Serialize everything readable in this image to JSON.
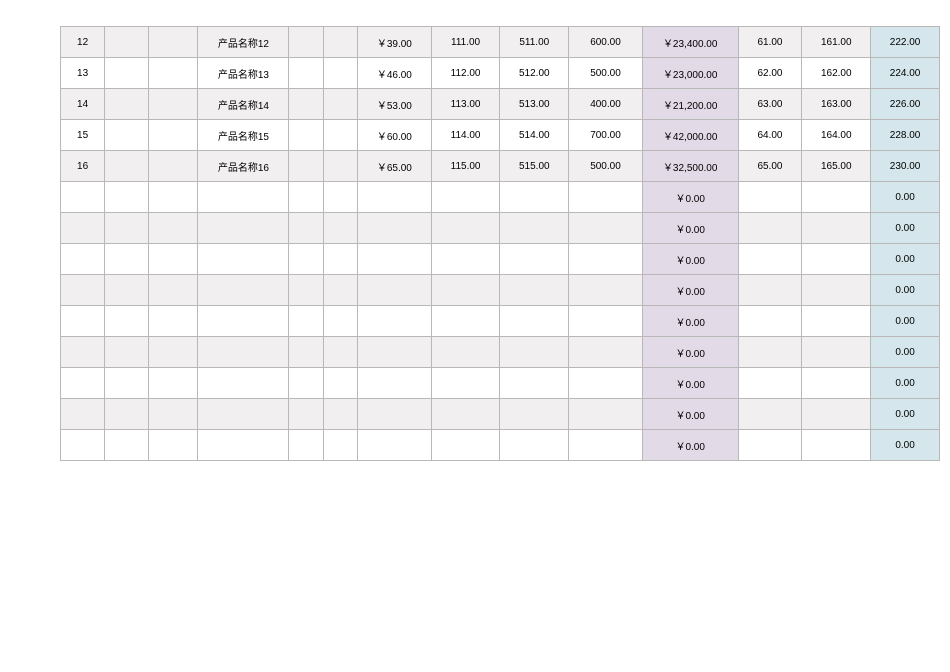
{
  "rows": [
    {
      "id": "12",
      "name": "产品名称12",
      "unit_price": "￥39.00",
      "v1": "111.00",
      "v2": "511.00",
      "qty": "600.00",
      "amount": "￥23,400.00",
      "a": "61.00",
      "b": "161.00",
      "last": "222.00",
      "stripe": true
    },
    {
      "id": "13",
      "name": "产品名称13",
      "unit_price": "￥46.00",
      "v1": "112.00",
      "v2": "512.00",
      "qty": "500.00",
      "amount": "￥23,000.00",
      "a": "62.00",
      "b": "162.00",
      "last": "224.00",
      "stripe": false
    },
    {
      "id": "14",
      "name": "产品名称14",
      "unit_price": "￥53.00",
      "v1": "113.00",
      "v2": "513.00",
      "qty": "400.00",
      "amount": "￥21,200.00",
      "a": "63.00",
      "b": "163.00",
      "last": "226.00",
      "stripe": true
    },
    {
      "id": "15",
      "name": "产品名称15",
      "unit_price": "￥60.00",
      "v1": "114.00",
      "v2": "514.00",
      "qty": "700.00",
      "amount": "￥42,000.00",
      "a": "64.00",
      "b": "164.00",
      "last": "228.00",
      "stripe": false
    },
    {
      "id": "16",
      "name": "产品名称16",
      "unit_price": "￥65.00",
      "v1": "115.00",
      "v2": "515.00",
      "qty": "500.00",
      "amount": "￥32,500.00",
      "a": "65.00",
      "b": "165.00",
      "last": "230.00",
      "stripe": true
    },
    {
      "id": "",
      "name": "",
      "unit_price": "",
      "v1": "",
      "v2": "",
      "qty": "",
      "amount": "￥0.00",
      "a": "",
      "b": "",
      "last": "0.00",
      "stripe": false
    },
    {
      "id": "",
      "name": "",
      "unit_price": "",
      "v1": "",
      "v2": "",
      "qty": "",
      "amount": "￥0.00",
      "a": "",
      "b": "",
      "last": "0.00",
      "stripe": true
    },
    {
      "id": "",
      "name": "",
      "unit_price": "",
      "v1": "",
      "v2": "",
      "qty": "",
      "amount": "￥0.00",
      "a": "",
      "b": "",
      "last": "0.00",
      "stripe": false
    },
    {
      "id": "",
      "name": "",
      "unit_price": "",
      "v1": "",
      "v2": "",
      "qty": "",
      "amount": "￥0.00",
      "a": "",
      "b": "",
      "last": "0.00",
      "stripe": true
    },
    {
      "id": "",
      "name": "",
      "unit_price": "",
      "v1": "",
      "v2": "",
      "qty": "",
      "amount": "￥0.00",
      "a": "",
      "b": "",
      "last": "0.00",
      "stripe": false
    },
    {
      "id": "",
      "name": "",
      "unit_price": "",
      "v1": "",
      "v2": "",
      "qty": "",
      "amount": "￥0.00",
      "a": "",
      "b": "",
      "last": "0.00",
      "stripe": true
    },
    {
      "id": "",
      "name": "",
      "unit_price": "",
      "v1": "",
      "v2": "",
      "qty": "",
      "amount": "￥0.00",
      "a": "",
      "b": "",
      "last": "0.00",
      "stripe": false
    },
    {
      "id": "",
      "name": "",
      "unit_price": "",
      "v1": "",
      "v2": "",
      "qty": "",
      "amount": "￥0.00",
      "a": "",
      "b": "",
      "last": "0.00",
      "stripe": true
    },
    {
      "id": "",
      "name": "",
      "unit_price": "",
      "v1": "",
      "v2": "",
      "qty": "",
      "amount": "￥0.00",
      "a": "",
      "b": "",
      "last": "0.00",
      "stripe": false
    }
  ]
}
